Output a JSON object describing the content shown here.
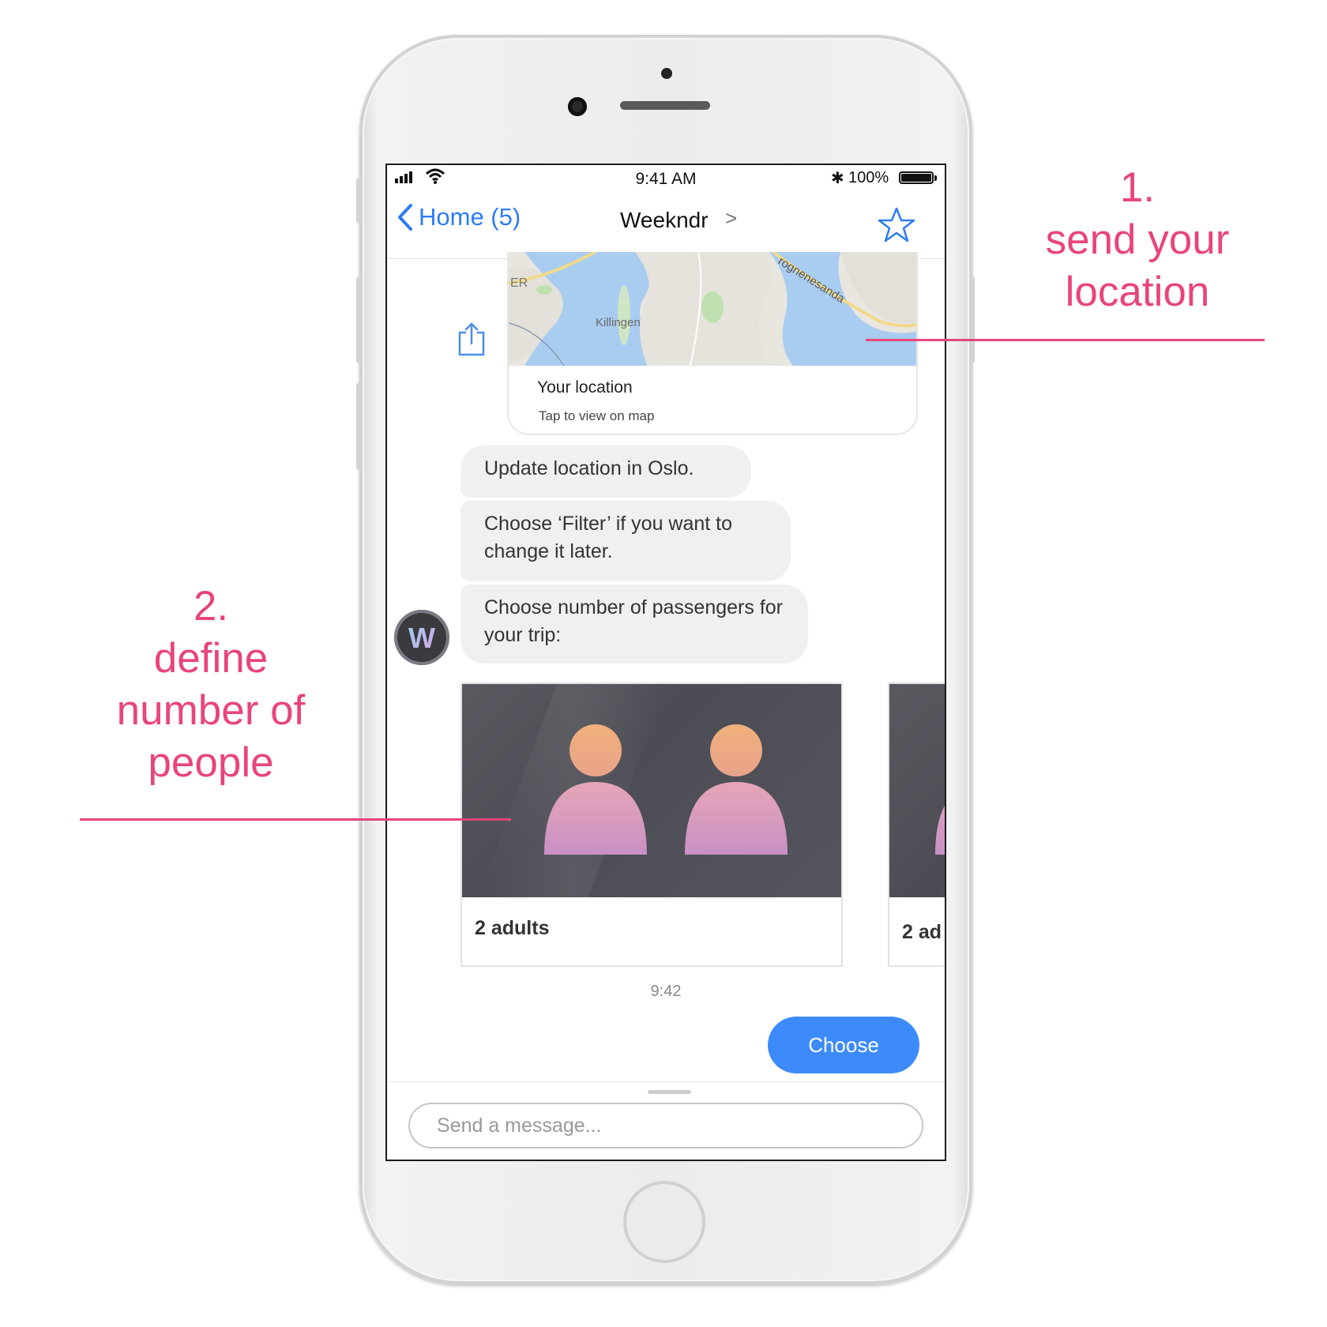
{
  "status_bar": {
    "time": "9:41 AM",
    "battery": "100%"
  },
  "nav": {
    "back_label": "Home (5)",
    "title": "Weekndr",
    "chevron": ">"
  },
  "location_card": {
    "map_labels": [
      "ER",
      "Killingen",
      "rognenesanda"
    ],
    "title": "Your location",
    "subtitle": "Tap to view on map"
  },
  "messages": [
    "Update location in Oslo.",
    "Choose ‘Filter’ if you want to change it later.",
    "Choose number of passengers for your trip:"
  ],
  "avatar_letter": "W",
  "carousel": [
    {
      "label": "2 adults"
    },
    {
      "label": "2 ad"
    }
  ],
  "timestamp": "9:42",
  "choose_button": "Choose",
  "composer": {
    "placeholder": "Send a message..."
  },
  "annotations": {
    "one": {
      "number": "1.",
      "line1": "send your",
      "line2": "location"
    },
    "two": {
      "number": "2.",
      "line1": "define",
      "line2": "number of",
      "line3": "people"
    }
  },
  "colors": {
    "accent": "#3d8bfb",
    "annotation": "#e8457a",
    "bubble": "#f0f0f2"
  }
}
